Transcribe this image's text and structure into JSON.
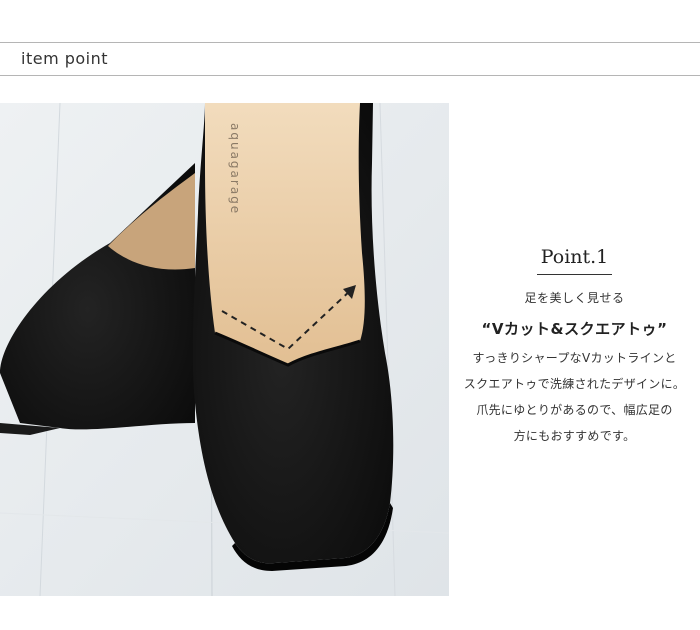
{
  "header": {
    "title": "item point"
  },
  "photo": {
    "brand_mark": "aquagarage"
  },
  "point": {
    "title": "Point.1",
    "subtitle": "足を美しく見せる",
    "headline": "“Vカット&スクエアトゥ”",
    "lines": [
      "すっきりシャープなVカットラインと",
      "スクエアトゥで洗練されたデザインに。",
      "爪先にゆとりがあるので、幅広足の",
      "方にもおすすめです。"
    ]
  },
  "colors": {
    "background": "#ffffff",
    "rule": "#b5b5b5",
    "shoe_black": "#141414",
    "insole_beige": "#e8c9a2"
  }
}
